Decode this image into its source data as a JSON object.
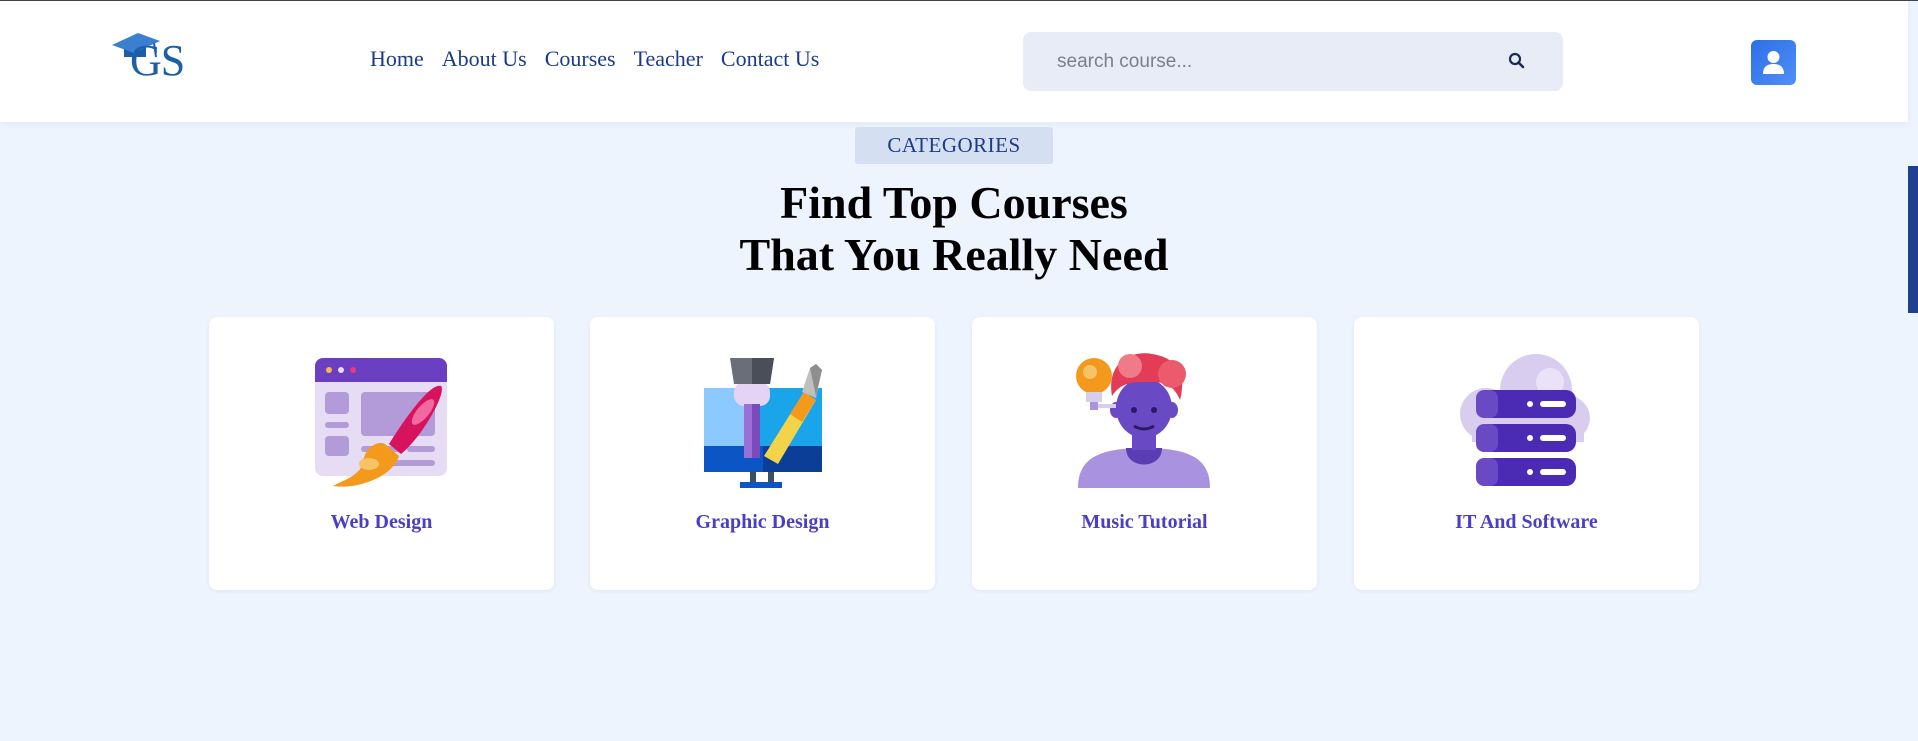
{
  "header": {
    "logo_text": "GS",
    "nav": [
      "Home",
      "About Us",
      "Courses",
      "Teacher",
      "Contact Us"
    ],
    "search": {
      "placeholder": "search course...",
      "value": ""
    },
    "icons": {
      "search": "search-icon",
      "user": "user-icon"
    }
  },
  "section": {
    "tag": "CATEGORIES",
    "heading_line1": "Find Top Courses",
    "heading_line2": "That You Really Need"
  },
  "categories": [
    {
      "label": "Web Design",
      "icon": "web-design-icon"
    },
    {
      "label": "Graphic Design",
      "icon": "graphic-design-icon"
    },
    {
      "label": "Music Tutorial",
      "icon": "music-tutorial-icon"
    },
    {
      "label": "IT And Software",
      "icon": "it-software-icon"
    }
  ],
  "colors": {
    "accent": "#4a3ec6",
    "nav_text": "#1b3a8a",
    "page_bg": "#eef4fd",
    "user_button": "#2e6fe8"
  }
}
